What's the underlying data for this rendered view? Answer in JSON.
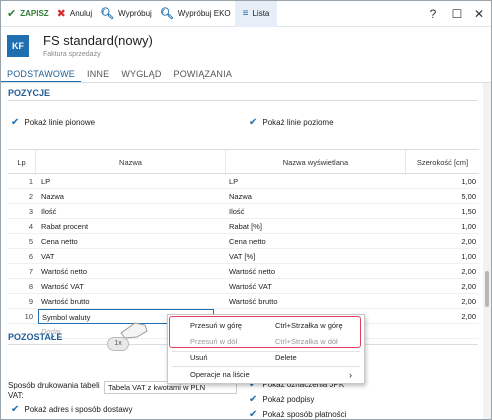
{
  "toolbar": {
    "save": "ZAPISZ",
    "cancel": "Anuluj",
    "try": "Wypróbuj",
    "try_eko": "Wypróbuj EKO",
    "list": "Lista",
    "help": "?",
    "maximize": "☐",
    "close": "✕"
  },
  "header": {
    "badge": "KF",
    "title": "FS standard(nowy)",
    "subtitle": "Faktura sprzedaży"
  },
  "tabs": [
    "PODSTAWOWE",
    "INNE",
    "WYGLĄD",
    "POWIĄZANIA"
  ],
  "positions": {
    "title": "POZYCJE",
    "show_vertical": "Pokaż linie pionowe",
    "show_horizontal": "Pokaż linie poziome",
    "columns": [
      "Lp",
      "Nazwa",
      "Nazwa wyświetlana",
      "Szerokość [cm]"
    ],
    "rows": [
      {
        "lp": "1",
        "name": "LP",
        "display": "LP",
        "width": "1,00"
      },
      {
        "lp": "2",
        "name": "Nazwa",
        "display": "Nazwa",
        "width": "5,00"
      },
      {
        "lp": "3",
        "name": "Ilość",
        "display": "Ilość",
        "width": "1,50"
      },
      {
        "lp": "4",
        "name": "Rabat procent",
        "display": "Rabat [%]",
        "width": "1,00"
      },
      {
        "lp": "5",
        "name": "Cena netto",
        "display": "Cena netto",
        "width": "2,00"
      },
      {
        "lp": "6",
        "name": "VAT",
        "display": "VAT [%]",
        "width": "1,00"
      },
      {
        "lp": "7",
        "name": "Wartość netto",
        "display": "Wartość netto",
        "width": "2,00"
      },
      {
        "lp": "8",
        "name": "Wartość VAT",
        "display": "Wartość VAT",
        "width": "2,00"
      },
      {
        "lp": "9",
        "name": "Wartość brutto",
        "display": "Wartość brutto",
        "width": "2,00"
      },
      {
        "lp": "10",
        "name": "Symbol waluty",
        "display": "",
        "width": "2,00"
      }
    ],
    "add_placeholder": "Dodaj"
  },
  "context_menu": {
    "move_up": "Przesuń w górę",
    "move_up_shortcut": "Ctrl+Strzałka w górę",
    "move_down": "Przesuń w dół",
    "move_down_shortcut": "Ctrl+Strzałka w dół",
    "delete": "Usuń",
    "delete_shortcut": "Delete",
    "list_ops": "Operacje na liście"
  },
  "click_badge": "1x",
  "other": {
    "title": "POZOSTAŁE",
    "vat_label": "Sposób drukowania tabeli VAT:",
    "vat_value": "Tabela VAT z kwotami w PLN",
    "show_address": "Pokaż adres i sposób dostawy",
    "show_jpk": "Pokaż oznaczenia JPK",
    "show_signatures": "Pokaż podpisy",
    "show_payment": "Pokaż sposób płatności"
  },
  "colors": {
    "accent": "#1f6fb0",
    "save_green": "#2e7d32",
    "cancel_red": "#d32f2f",
    "highlight": "#e0405a"
  }
}
